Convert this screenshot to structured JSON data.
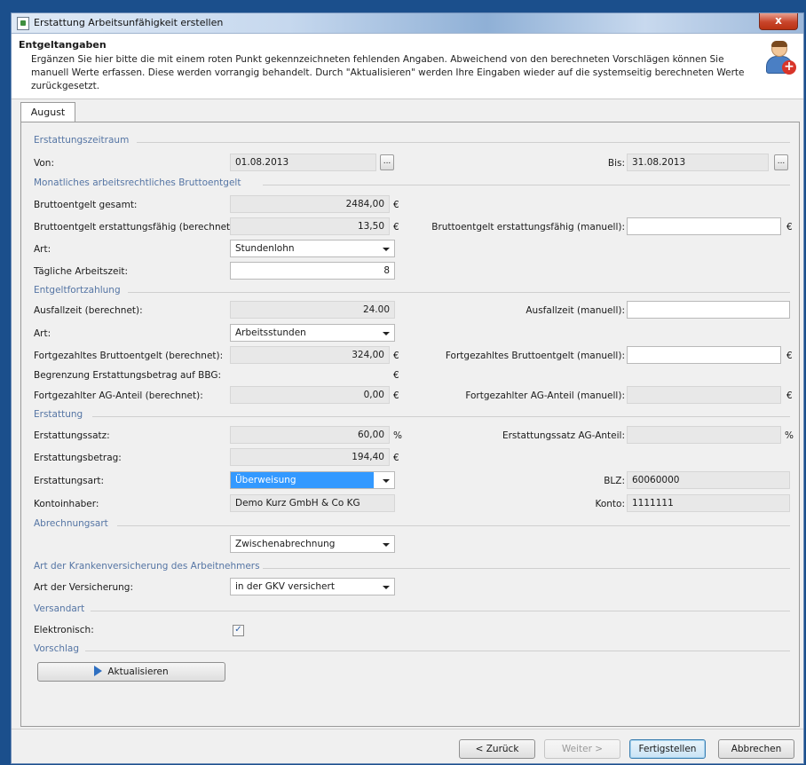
{
  "window": {
    "title": "Erstattung Arbeitsunfähigkeit erstellen",
    "close_label": "x"
  },
  "header": {
    "title": "Entgeltangaben",
    "description": "Ergänzen Sie hier bitte die mit einem roten Punkt gekennzeichneten fehlenden Angaben. Abweichend von den berechneten Vorschlägen können Sie manuell Werte erfassen. Diese werden vorrangig behandelt. Durch \"Aktualisieren\" werden Ihre Eingaben wieder auf die systemseitig berechneten Werte zurückgesetzt."
  },
  "tabs": [
    {
      "label": "August"
    }
  ],
  "zeitraum": {
    "section": "Erstattungszeitraum",
    "von_label": "Von:",
    "von_value": "01.08.2013",
    "bis_label": "Bis:",
    "bis_value": "31.08.2013",
    "picker_label": "..."
  },
  "brutto": {
    "section": "Monatliches arbeitsrechtliches Bruttoentgelt",
    "gesamt_label": "Bruttoentgelt gesamt:",
    "gesamt_value": "2484,00",
    "erst_label": "Bruttoentgelt erstattungsfähig (berechnet):",
    "erst_value": "13,50",
    "erst_manual_label": "Bruttoentgelt erstattungsfähig (manuell):",
    "erst_manual_value": "",
    "art_label": "Art:",
    "art_value": "Stundenlohn",
    "arbeitszeit_label": "Tägliche Arbeitszeit:",
    "arbeitszeit_value": "8"
  },
  "fortzahlung": {
    "section": "Entgeltfortzahlung",
    "ausfall_label": "Ausfallzeit (berechnet):",
    "ausfall_value": "24.00",
    "ausfall_manual_label": "Ausfallzeit (manuell):",
    "ausfall_manual_value": "",
    "art_label": "Art:",
    "art_value": "Arbeitsstunden",
    "fort_label": "Fortgezahltes Bruttoentgelt (berechnet):",
    "fort_value": "324,00",
    "fort_manual_label": "Fortgezahltes Bruttoentgelt (manuell):",
    "fort_manual_value": "",
    "bbg_label": "Begrenzung Erstattungsbetrag auf BBG:",
    "bbg_value": "",
    "ag_label": "Fortgezahlter AG-Anteil (berechnet):",
    "ag_value": "0,00",
    "ag_manual_label": "Fortgezahlter AG-Anteil (manuell):",
    "ag_manual_value": ""
  },
  "erstattung": {
    "section": "Erstattung",
    "satz_label": "Erstattungssatz:",
    "satz_value": "60,00",
    "satz_ag_label": "Erstattungssatz AG-Anteil:",
    "satz_ag_value": "",
    "betrag_label": "Erstattungsbetrag:",
    "betrag_value": "194,40",
    "art_label": "Erstattungsart:",
    "art_value": "Überweisung",
    "blz_label": "BLZ:",
    "blz_value": "60060000",
    "inhaber_label": "Kontoinhaber:",
    "inhaber_value": "Demo Kurz GmbH & Co KG",
    "konto_label": "Konto:",
    "konto_value": "1111111"
  },
  "abrechnung": {
    "section": "Abrechnungsart",
    "value": "Zwischenabrechnung"
  },
  "kv": {
    "section": "Art der Krankenversicherung des Arbeitnehmers",
    "label": "Art der Versicherung:",
    "value": "in der GKV versichert"
  },
  "versand": {
    "section": "Versandart",
    "label": "Elektronisch:",
    "checked": true,
    "check_glyph": "✓"
  },
  "vorschlag": {
    "section": "Vorschlag",
    "button": "Aktualisieren"
  },
  "units": {
    "euro": "€",
    "percent": "%"
  },
  "footer": {
    "back": "< Zurück",
    "next": "Weiter >",
    "finish": "Fertigstellen",
    "cancel": "Abbrechen"
  }
}
